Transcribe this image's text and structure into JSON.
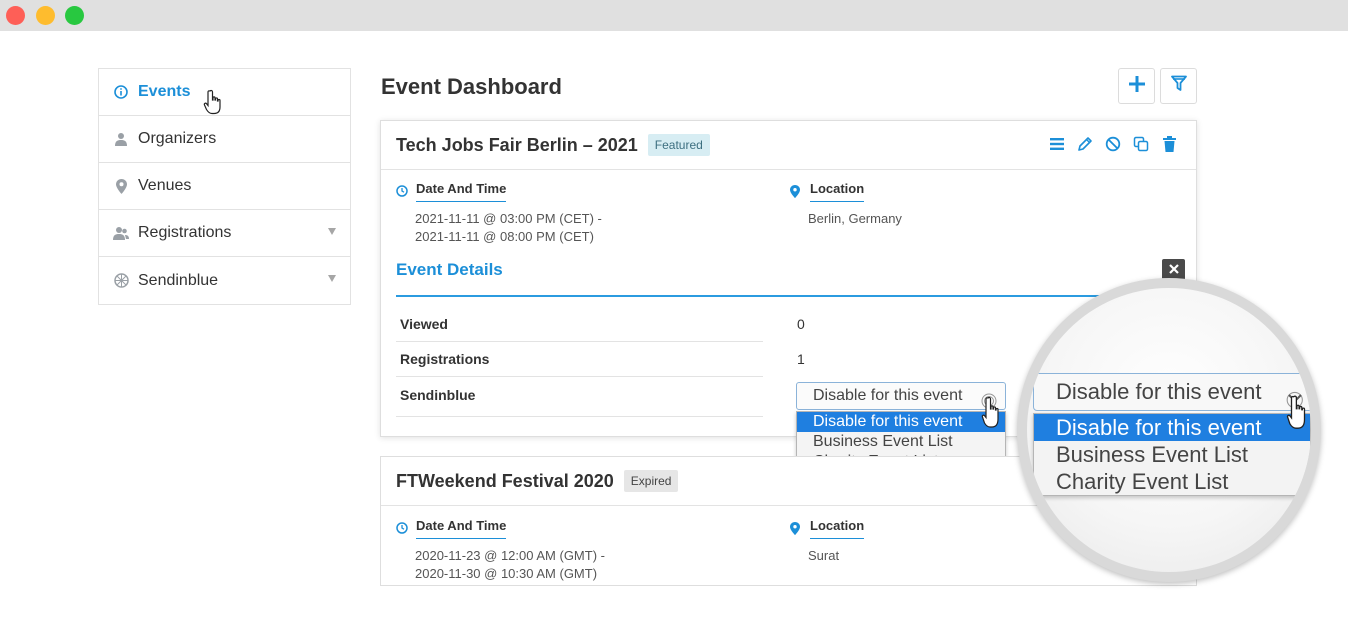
{
  "window": {
    "controls": [
      "close",
      "minimize",
      "maximize"
    ]
  },
  "sidebar": {
    "items": [
      {
        "label": "Events",
        "icon": "info-icon",
        "active": true
      },
      {
        "label": "Organizers",
        "icon": "user-icon"
      },
      {
        "label": "Venues",
        "icon": "map-pin-icon"
      },
      {
        "label": "Registrations",
        "icon": "users-icon",
        "has_submenu": true
      },
      {
        "label": "Sendinblue",
        "icon": "sendinblue-icon",
        "has_submenu": true
      }
    ]
  },
  "header": {
    "title": "Event Dashboard",
    "buttons": [
      "plus-icon",
      "filter-icon"
    ]
  },
  "events": [
    {
      "title": "Tech Jobs Fair Berlin – 2021",
      "badge": "Featured",
      "date_label": "Date And Time",
      "date_start": "2021-11-11 @ 03:00 PM (CET) -",
      "date_end": "2021-11-11 @ 08:00 PM (CET)",
      "location_label": "Location",
      "location": "Berlin, Germany",
      "details_title": "Event Details",
      "details": {
        "viewed_label": "Viewed",
        "viewed_value": "0",
        "registrations_label": "Registrations",
        "registrations_value": "1",
        "sendinblue_label": "Sendinblue"
      },
      "actions": [
        "list-icon",
        "edit-icon",
        "disable-icon",
        "copy-icon",
        "trash-icon"
      ]
    },
    {
      "title": "FTWeekend Festival 2020",
      "badge": "Expired",
      "date_label": "Date And Time",
      "date_start": "2020-11-23 @ 12:00 AM (GMT) -",
      "date_end": "2020-11-30 @ 10:30 AM (GMT)",
      "location_label": "Location",
      "location": "Surat"
    }
  ],
  "sendinblue_select": {
    "selected": "Disable for this event",
    "options": [
      "Disable for this event",
      "Business Event List",
      "Charity Event List"
    ]
  },
  "colors": {
    "accent": "#1c8fd8",
    "selected_option": "#1f7fe0"
  }
}
